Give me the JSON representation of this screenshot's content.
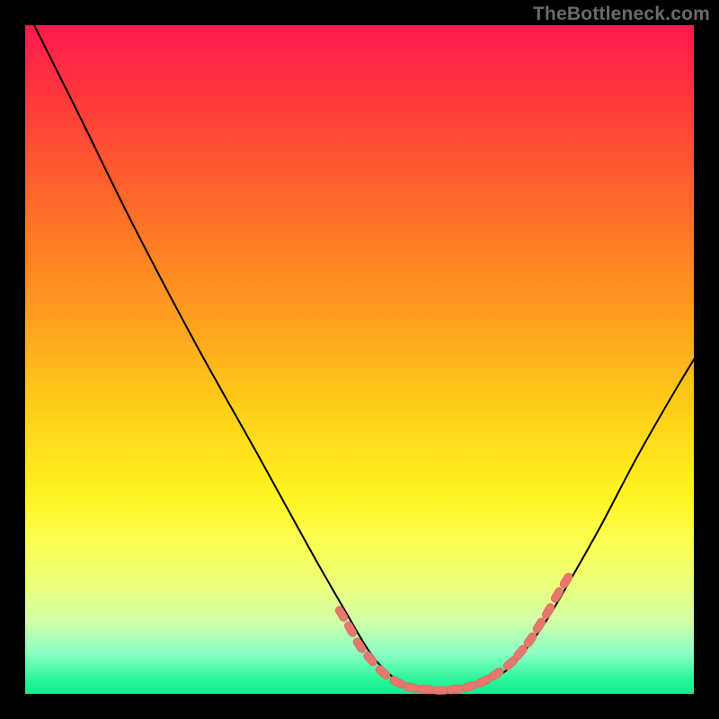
{
  "watermark": "TheBottleneck.com",
  "colors": {
    "page_bg": "#000000",
    "curve": "#000000",
    "marker_fill": "#e7786d",
    "marker_stroke": "#d9635a"
  },
  "chart_data": {
    "type": "line",
    "title": "",
    "xlabel": "",
    "ylabel": "",
    "xlim": [
      0,
      744
    ],
    "ylim_pixels": [
      0,
      744
    ],
    "note": "Axes are unlabeled; values are pixel coordinates inside the 744×744 plot area. Y increases downward (pixel space). Lower y ≈ higher bottleneck mismatch; valley bottom ≈ balanced.",
    "series": [
      {
        "name": "bottleneck-curve",
        "points": [
          {
            "x": 10,
            "y": 0
          },
          {
            "x": 60,
            "y": 100
          },
          {
            "x": 120,
            "y": 222
          },
          {
            "x": 190,
            "y": 355
          },
          {
            "x": 260,
            "y": 480
          },
          {
            "x": 315,
            "y": 580
          },
          {
            "x": 355,
            "y": 650
          },
          {
            "x": 385,
            "y": 700
          },
          {
            "x": 410,
            "y": 726
          },
          {
            "x": 435,
            "y": 737
          },
          {
            "x": 462,
            "y": 740
          },
          {
            "x": 490,
            "y": 738
          },
          {
            "x": 515,
            "y": 730
          },
          {
            "x": 542,
            "y": 712
          },
          {
            "x": 575,
            "y": 670
          },
          {
            "x": 605,
            "y": 620
          },
          {
            "x": 640,
            "y": 558
          },
          {
            "x": 680,
            "y": 482
          },
          {
            "x": 720,
            "y": 412
          },
          {
            "x": 744,
            "y": 372
          }
        ]
      }
    ],
    "markers": {
      "name": "highlighted-range",
      "shape": "capsule",
      "points": [
        {
          "x": 352,
          "y": 655
        },
        {
          "x": 362,
          "y": 672
        },
        {
          "x": 372,
          "y": 690
        },
        {
          "x": 384,
          "y": 705
        },
        {
          "x": 398,
          "y": 720
        },
        {
          "x": 414,
          "y": 731
        },
        {
          "x": 430,
          "y": 737
        },
        {
          "x": 446,
          "y": 739
        },
        {
          "x": 462,
          "y": 740
        },
        {
          "x": 478,
          "y": 739
        },
        {
          "x": 494,
          "y": 736
        },
        {
          "x": 510,
          "y": 730
        },
        {
          "x": 524,
          "y": 722
        },
        {
          "x": 540,
          "y": 710
        },
        {
          "x": 551,
          "y": 698
        },
        {
          "x": 562,
          "y": 684
        },
        {
          "x": 572,
          "y": 668
        },
        {
          "x": 582,
          "y": 652
        },
        {
          "x": 592,
          "y": 634
        },
        {
          "x": 602,
          "y": 618
        }
      ]
    }
  }
}
